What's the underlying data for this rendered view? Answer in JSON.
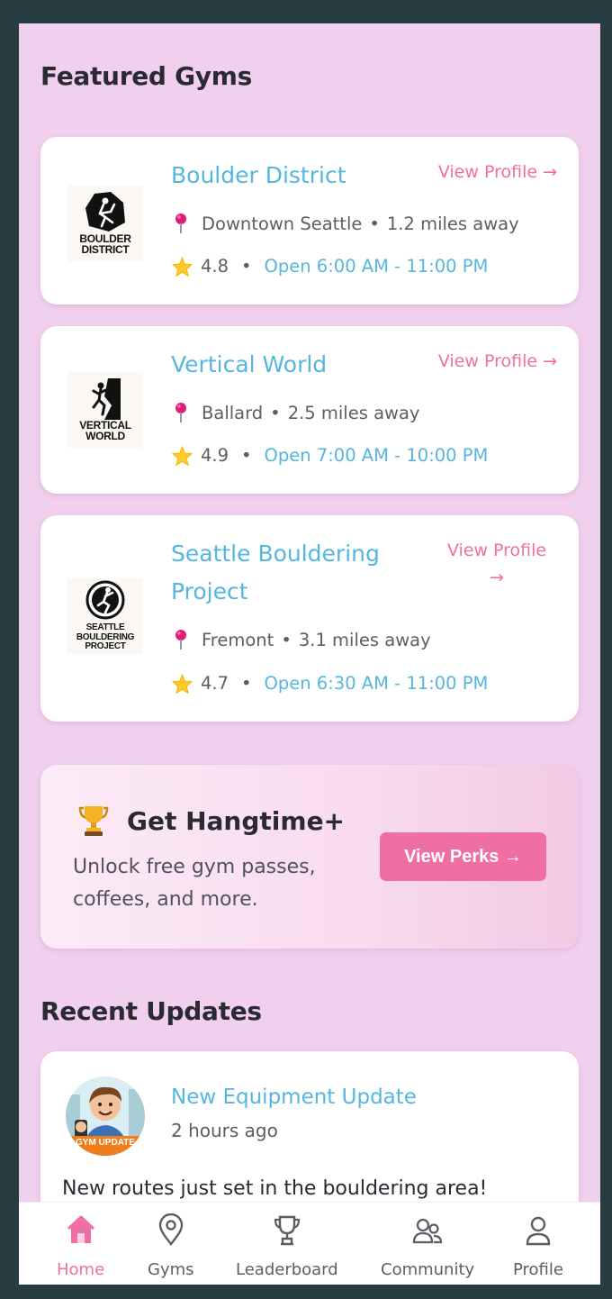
{
  "featured": {
    "title": "Featured Gyms",
    "view_profile_label": "View Profile →",
    "gyms": [
      {
        "name": "Boulder District",
        "logo_text": "BOULDER\nDISTRICT",
        "location": "Downtown Seattle",
        "distance": "1.2 miles away",
        "rating": "4.8",
        "hours": "Open 6:00 AM - 11:00 PM"
      },
      {
        "name": "Vertical World",
        "logo_text": "VERTICAL\nWORLD",
        "location": "Ballard",
        "distance": "2.5 miles away",
        "rating": "4.9",
        "hours": "Open 7:00 AM - 10:00 PM"
      },
      {
        "name": "Seattle Bouldering Project",
        "logo_text": "SEATTLE\nBOULDERING\nPROJECT",
        "location": "Fremont",
        "distance": "3.1 miles away",
        "rating": "4.7",
        "hours": "Open 6:30 AM - 11:00 PM"
      }
    ]
  },
  "promo": {
    "icon": "trophy-icon",
    "title": "Get Hangtime+",
    "description": "Unlock free gym passes, coffees, and more.",
    "button_label": "View Perks →"
  },
  "updates": {
    "title": "Recent Updates",
    "items": [
      {
        "avatar_badge": "GYM UPDATE",
        "title": "New Equipment Update",
        "time": "2 hours ago",
        "body": "New routes just set in the bouldering area!"
      }
    ]
  },
  "nav": {
    "active": "Home",
    "items": [
      {
        "label": "Home",
        "icon": "home-icon"
      },
      {
        "label": "Gyms",
        "icon": "map-pin-icon"
      },
      {
        "label": "Leaderboard",
        "icon": "trophy-icon"
      },
      {
        "label": "Community",
        "icon": "users-icon"
      },
      {
        "label": "Profile",
        "icon": "user-icon"
      }
    ]
  },
  "colors": {
    "background": "#f1cfee",
    "accent_pink": "#ef6fa5",
    "accent_blue": "#55b6de",
    "outer": "#263c40"
  }
}
